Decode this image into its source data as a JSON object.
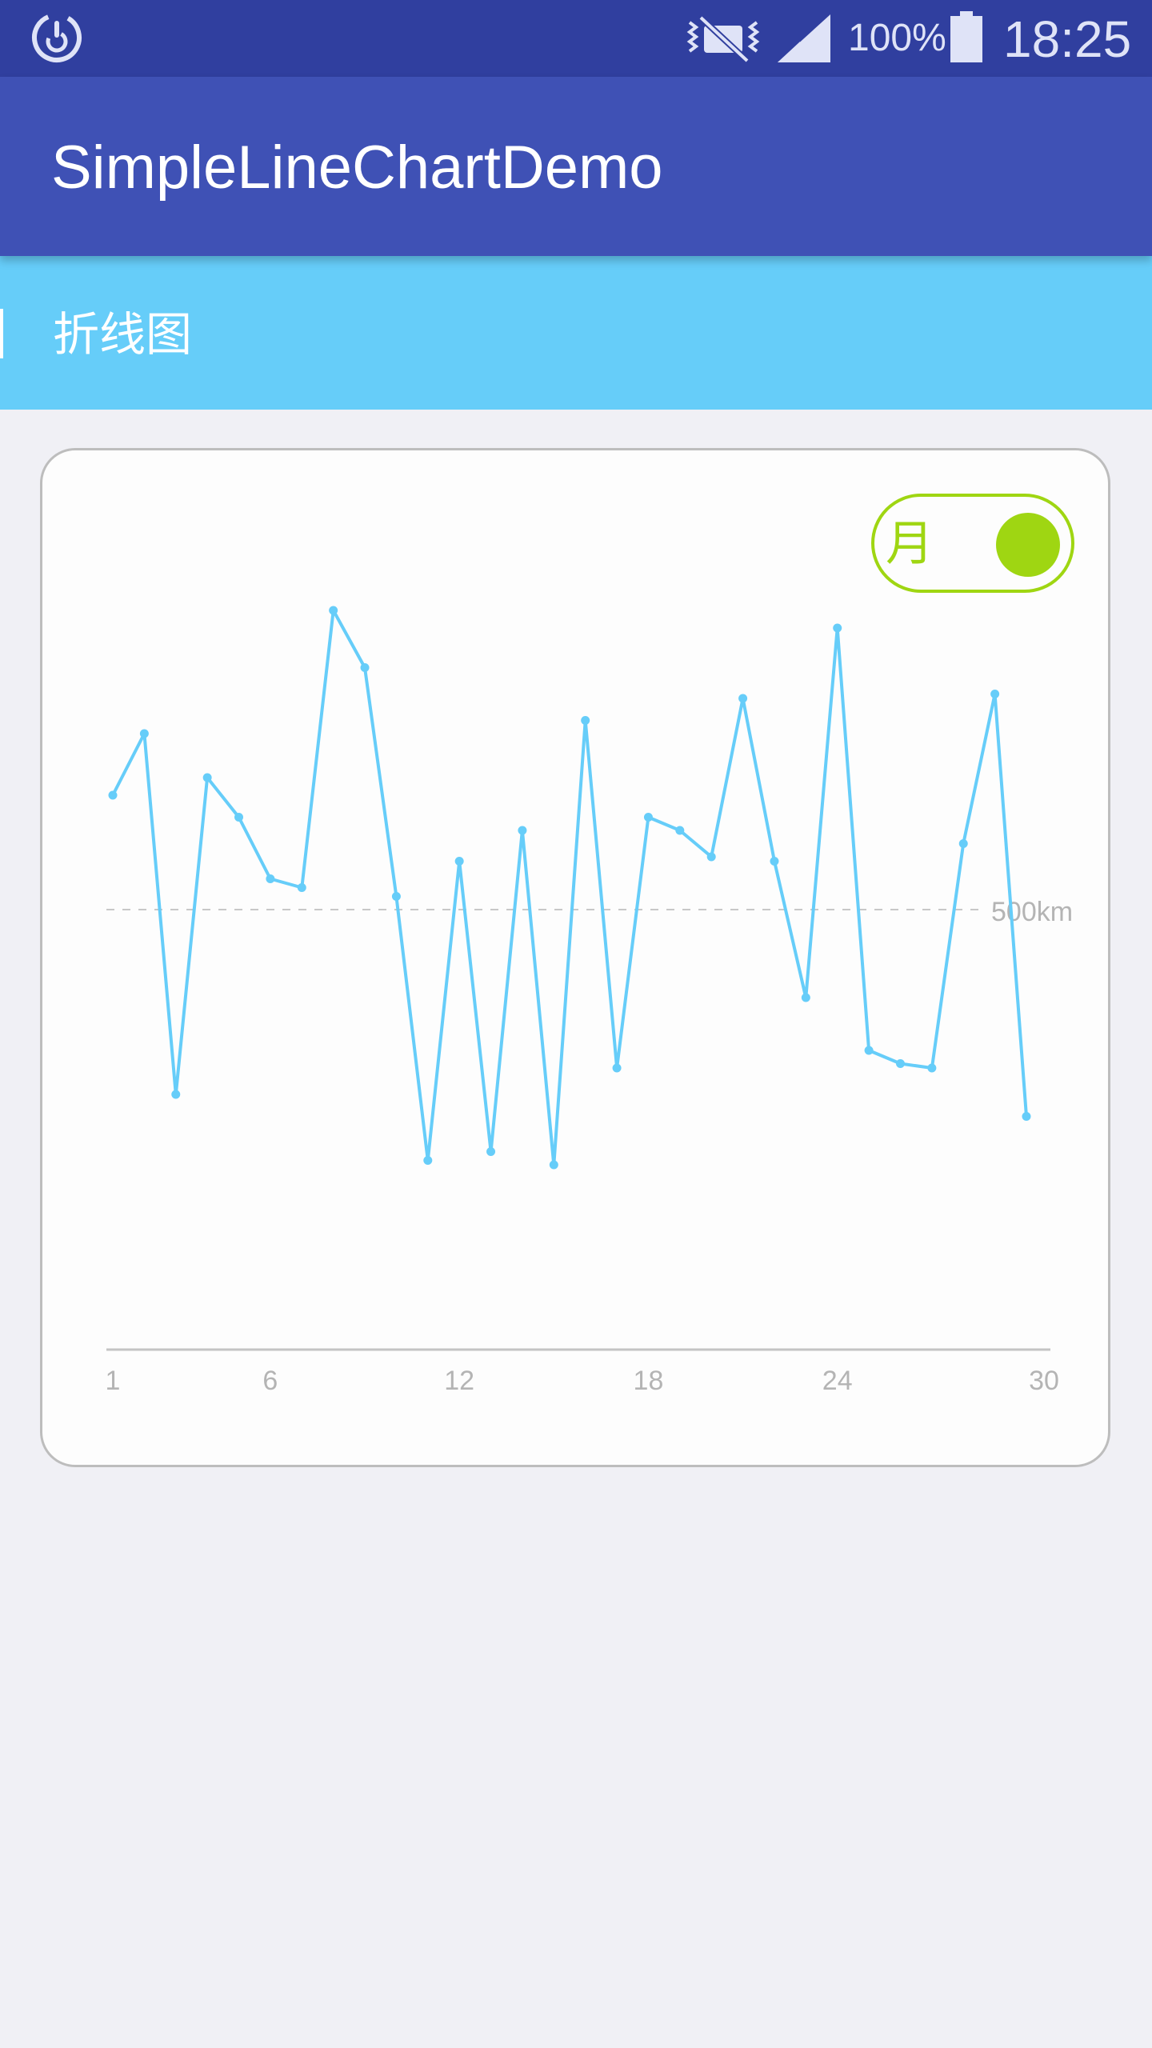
{
  "status_bar": {
    "battery": "100%",
    "time": "18:25",
    "icons": [
      "sync-icon",
      "mute-icon",
      "signal-icon",
      "battery-icon"
    ]
  },
  "app_bar": {
    "title": "SimpleLineChartDemo",
    "color": "#3f51b5"
  },
  "sub_bar": {
    "title": "折线图",
    "color": "#66cdf9"
  },
  "toggle": {
    "label": "月",
    "on": true,
    "color": "#9fd612"
  },
  "chart_data": {
    "type": "line",
    "x": [
      1,
      2,
      3,
      4,
      5,
      6,
      7,
      8,
      9,
      10,
      11,
      12,
      13,
      14,
      15,
      16,
      17,
      18,
      19,
      20,
      21,
      22,
      23,
      24,
      25,
      26,
      27,
      28,
      29,
      30
    ],
    "series": [
      {
        "values": [
          630,
          700,
          290,
          650,
          605,
          535,
          525,
          840,
          775,
          515,
          215,
          555,
          225,
          590,
          210,
          715,
          320,
          605,
          590,
          560,
          740,
          555,
          400,
          820,
          340,
          325,
          320,
          575,
          745,
          265
        ],
        "color": "#66cdf9"
      }
    ],
    "xticks": [
      1,
      6,
      12,
      18,
      24,
      30
    ],
    "reference_line": {
      "value": 500,
      "label": "500km"
    },
    "ylim": [
      0,
      1000
    ],
    "grid": false
  }
}
